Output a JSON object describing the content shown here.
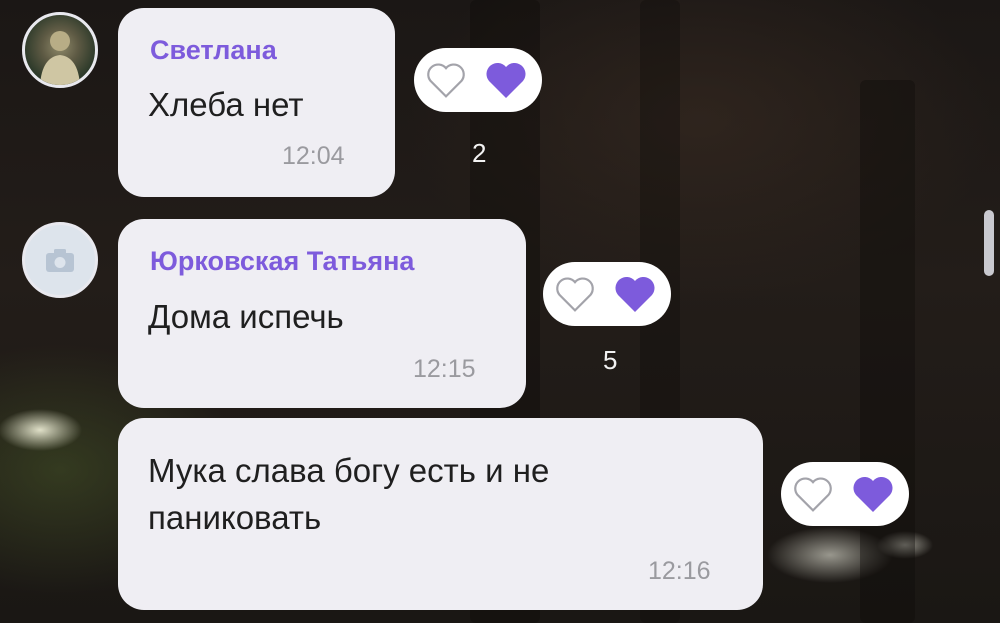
{
  "messages": [
    {
      "sender": "Светлана",
      "text": "Хлеба нет",
      "time": "12:04",
      "reaction_count": "2",
      "avatar_icon": "user-photo-icon"
    },
    {
      "sender": "Юрковская Татьяна",
      "text": "Дома испечь",
      "time": "12:15",
      "reaction_count": "5",
      "avatar_icon": "camera-icon"
    },
    {
      "sender": "",
      "text_line1": "Мука слава богу есть и не",
      "text_line2": "паниковать",
      "time": "12:16"
    }
  ],
  "colors": {
    "accent": "#7d5bdc",
    "heart_filled": "#7d5bdc",
    "bubble": "#efeef3"
  },
  "icons": [
    "heart-outline-icon",
    "heart-filled-icon",
    "camera-icon"
  ]
}
